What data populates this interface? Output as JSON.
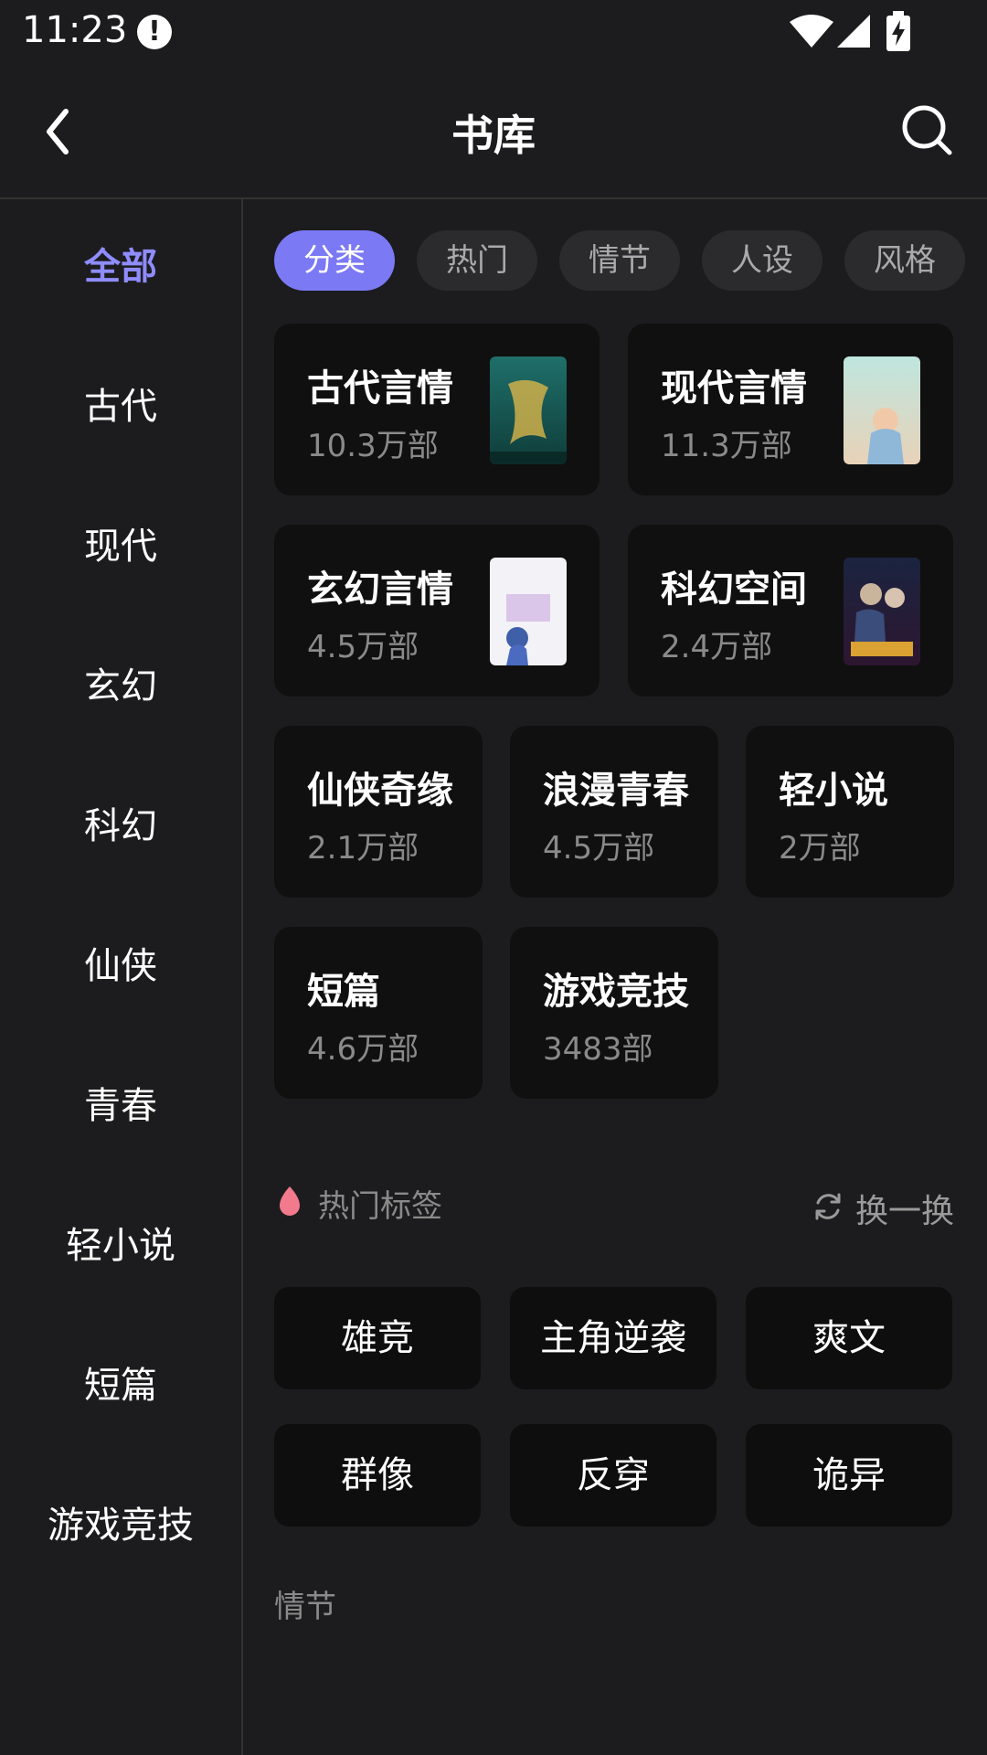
{
  "status": {
    "time": "11:23",
    "alert": "!"
  },
  "header": {
    "title": "书库"
  },
  "sidebar": {
    "items": [
      {
        "label": "全部"
      },
      {
        "label": "古代"
      },
      {
        "label": "现代"
      },
      {
        "label": "玄幻"
      },
      {
        "label": "科幻"
      },
      {
        "label": "仙侠"
      },
      {
        "label": "青春"
      },
      {
        "label": "轻小说"
      },
      {
        "label": "短篇"
      },
      {
        "label": "游戏竞技"
      }
    ],
    "active": "全部"
  },
  "tabs": [
    {
      "label": "分类"
    },
    {
      "label": "热门"
    },
    {
      "label": "情节"
    },
    {
      "label": "人设"
    },
    {
      "label": "风格"
    }
  ],
  "categories": [
    {
      "title": "古代言情",
      "count": "10.3万部"
    },
    {
      "title": "现代言情",
      "count": "11.3万部"
    },
    {
      "title": "玄幻言情",
      "count": "4.5万部"
    },
    {
      "title": "科幻空间",
      "count": "2.4万部"
    },
    {
      "title": "仙侠奇缘",
      "count": "2.1万部"
    },
    {
      "title": "浪漫青春",
      "count": "4.5万部"
    },
    {
      "title": "轻小说",
      "count": "2万部"
    },
    {
      "title": "短篇",
      "count": "4.6万部"
    },
    {
      "title": "游戏竞技",
      "count": "3483部"
    }
  ],
  "hot_tags": {
    "title": "热门标签",
    "refresh_label": "换一换",
    "tags": [
      {
        "label": "雄竞"
      },
      {
        "label": "主角逆袭"
      },
      {
        "label": "爽文"
      },
      {
        "label": "群像"
      },
      {
        "label": "反穿"
      },
      {
        "label": "诡异"
      }
    ]
  },
  "next_section": {
    "title": "情节"
  },
  "colors": {
    "accent": "#7c79f5",
    "active_text": "#8f8cff",
    "background": "#1c1c1e",
    "card": "#101010"
  }
}
